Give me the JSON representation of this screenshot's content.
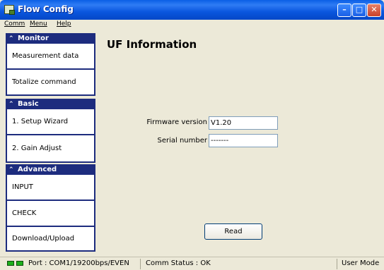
{
  "window": {
    "title": "Flow Config"
  },
  "menu": {
    "items": [
      "Comm",
      "Menu",
      "Help"
    ]
  },
  "sidebar": {
    "sections": [
      {
        "title": "Monitor",
        "items": [
          "Measurement data",
          "Totalize command"
        ]
      },
      {
        "title": "Basic",
        "items": [
          "1. Setup Wizard",
          "2. Gain Adjust"
        ]
      },
      {
        "title": "Advanced",
        "items": [
          "INPUT",
          "CHECK",
          "Download/Upload"
        ]
      }
    ]
  },
  "main": {
    "title": "UF Information",
    "fields": [
      {
        "label": "Firmware version",
        "value": "V1.20"
      },
      {
        "label": "Serial number",
        "value": "-------"
      }
    ],
    "read_button": "Read"
  },
  "status": {
    "port": "Port : COM1/19200bps/EVEN",
    "comm": "Comm Status :  OK",
    "mode": "User Mode"
  },
  "colors": {
    "titlebar": "#0a56de",
    "sidebar_header": "#1d2c7e",
    "led": "#1cb01c"
  }
}
